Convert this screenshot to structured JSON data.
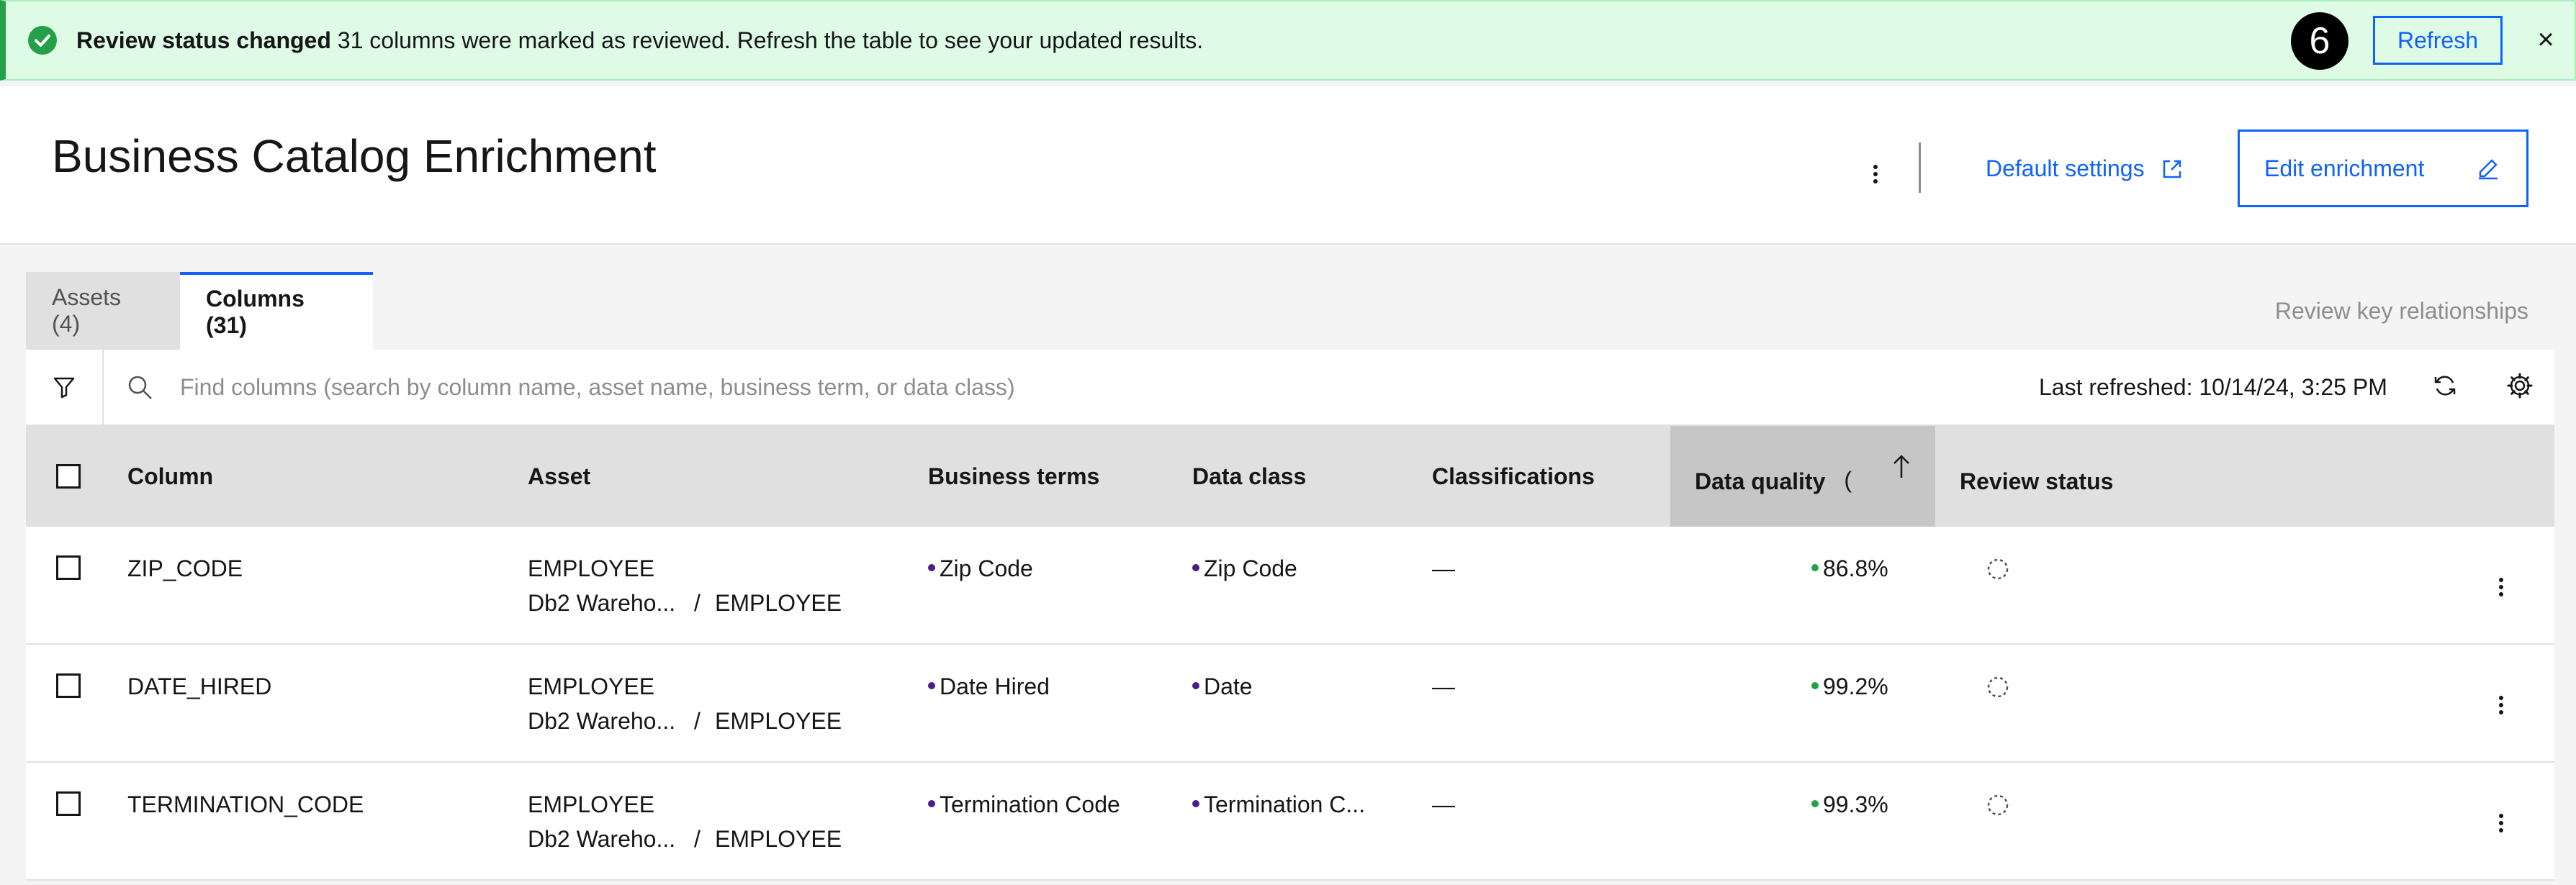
{
  "banner": {
    "title": "Review status changed",
    "message": "31 columns were marked as reviewed. Refresh the table to see your updated results.",
    "step_badge": "6",
    "refresh_label": "Refresh",
    "close_glyph": "×",
    "status_color": "#24a148"
  },
  "header": {
    "title": "Business Catalog Enrichment",
    "default_settings_label": "Default settings",
    "edit_enrichment_label": "Edit enrichment"
  },
  "tabs": [
    {
      "label": "Assets (4)",
      "active": false
    },
    {
      "label": "Columns (31)",
      "active": true
    }
  ],
  "review_key_label": "Review key relationships",
  "toolbar": {
    "search_placeholder": "Find columns (search by column name, asset name, business term, or data class)",
    "last_refreshed": "Last refreshed: 10/14/24, 3:25 PM"
  },
  "table": {
    "headers": {
      "column": "Column",
      "asset": "Asset",
      "business_terms": "Business terms",
      "data_class": "Data class",
      "classifications": "Classifications",
      "data_quality": "Data quality",
      "review_status": "Review status"
    },
    "sort": {
      "column": "data_quality",
      "direction": "ascending"
    },
    "rows": [
      {
        "column": "ZIP_CODE",
        "asset": "EMPLOYEE",
        "asset_path_left": "Db2 Wareho...",
        "asset_path_sep": "/",
        "asset_path_right": "EMPLOYEE",
        "business_term": "Zip Code",
        "data_class": "Zip Code",
        "classifications": "—",
        "data_quality": "86.8%"
      },
      {
        "column": "DATE_HIRED",
        "asset": "EMPLOYEE",
        "asset_path_left": "Db2 Wareho...",
        "asset_path_sep": "/",
        "asset_path_right": "EMPLOYEE",
        "business_term": "Date Hired",
        "data_class": "Date",
        "classifications": "—",
        "data_quality": "99.2%"
      },
      {
        "column": "TERMINATION_CODE",
        "asset": "EMPLOYEE",
        "asset_path_left": "Db2 Wareho...",
        "asset_path_sep": "/",
        "asset_path_right": "EMPLOYEE",
        "business_term": "Termination Code",
        "data_class": "Termination C...",
        "classifications": "—",
        "data_quality": "99.3%"
      }
    ]
  }
}
